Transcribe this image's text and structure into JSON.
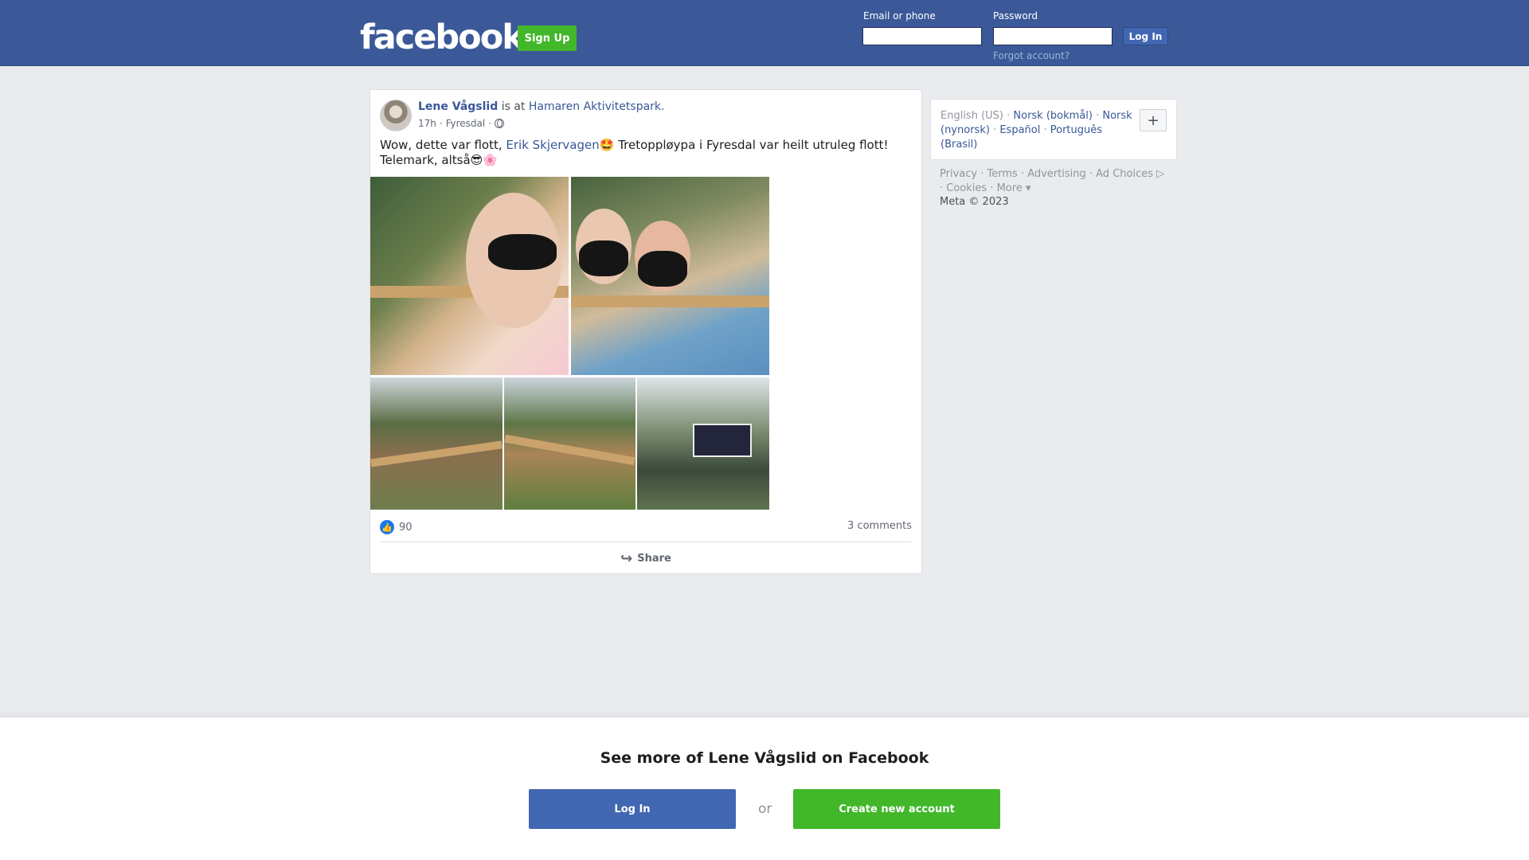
{
  "header": {
    "logo": "facebook",
    "signup_label": "Sign Up",
    "email_label": "Email or phone",
    "password_label": "Password",
    "login_label": "Log In",
    "forgot_label": "Forgot account?",
    "bg_color": "#3b5998"
  },
  "post": {
    "author": "Lene Vågslid",
    "is_at": "is at",
    "place": "Hamaren Aktivitetspark.",
    "time": "17h",
    "sep": "·",
    "location": "Fyresdal",
    "privacy_icon": "globe-icon",
    "text_before": "Wow, dette var flott,",
    "mention": "Erik Skjervagen",
    "text_after": "🤩 Tretoppløypa i Fyresdal var heilt utruleg flott! Telemark, altså😎🌸",
    "reactions_count": "90",
    "comments": "3 comments",
    "share_label": "Share"
  },
  "sidebar": {
    "languages": [
      "English (US)",
      "Norsk (bokmål)",
      "Norsk (nynorsk)",
      "Español",
      "Português (Brasil)"
    ],
    "add_language": "+",
    "footer_links": [
      "Privacy",
      "Terms",
      "Advertising",
      "Ad Choices",
      "Cookies",
      "More"
    ],
    "copyright": "Meta © 2023"
  },
  "banner": {
    "title": "See more of Lene Vågslid on Facebook",
    "login_label": "Log In",
    "or_label": "or",
    "create_label": "Create new account"
  }
}
